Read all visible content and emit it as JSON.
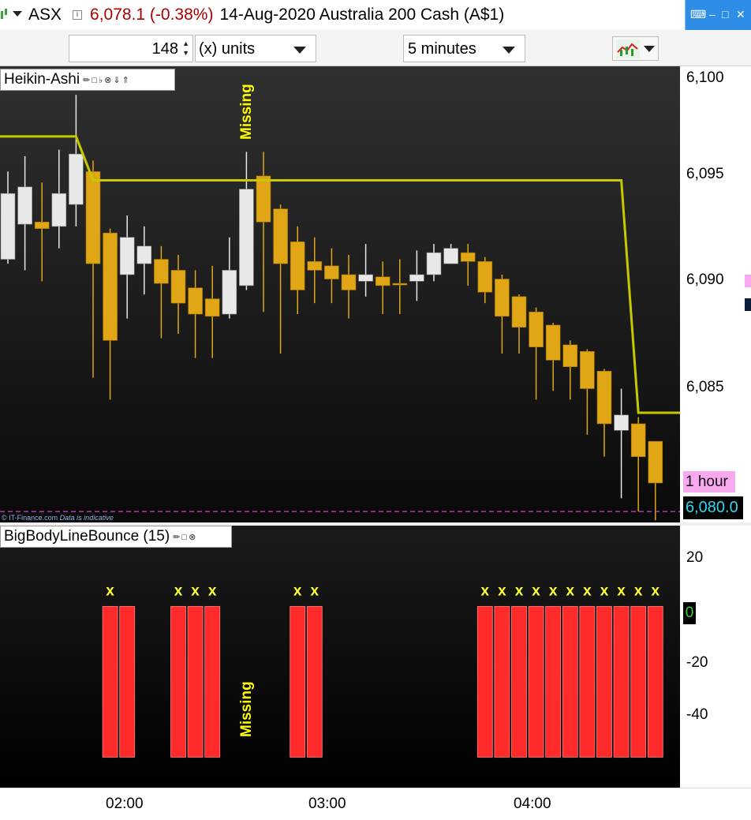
{
  "header": {
    "symbol": "ASX",
    "last": "6,078.1 (-0.38%)",
    "description": "14-Aug-2020 Australia 200 Cash (A$1)",
    "info_icon": "info-icon",
    "window_controls": [
      "keyboard-icon",
      "minimize-icon",
      "restore-icon",
      "close-icon"
    ]
  },
  "toolbar": {
    "quantity": "148",
    "units": "(x) units",
    "period": "5 minutes",
    "chart_type_icon": "chart-type-icon"
  },
  "price_pane": {
    "legend": "Heikin-Ashi",
    "missing_label": "Missing",
    "credit": "© IT-Finance.com",
    "credit_note": "Data is indicative",
    "hour_badge": "1 hour",
    "last_price": "6,080.0",
    "y_ticks": [
      "6,100",
      "6,095",
      "6,090",
      "6,085"
    ],
    "colors": {
      "bull": "#e8e8e8",
      "bear": "#e0a616",
      "line": "#c8c800",
      "dash": "#d23fd2"
    }
  },
  "indicator_pane": {
    "legend": "BigBodyLineBounce (15)",
    "missing_label": "Missing",
    "zero_badge": "0",
    "y_ticks": [
      "20",
      "-20",
      "-40"
    ],
    "marker": "x",
    "colors": {
      "bar": "#ff2a2a",
      "marker": "#ffff33"
    }
  },
  "x_axis": {
    "ticks": [
      "02:00",
      "03:00",
      "04:00"
    ]
  },
  "chart_data": [
    {
      "type": "candlestick",
      "title": "Heikin-Ashi",
      "ylim": [
        6079.5,
        6100.3
      ],
      "candles": [
        {
          "o": 6091.5,
          "c": 6094.5,
          "h": 6095.5,
          "l": 6091.3,
          "bull": true
        },
        {
          "o": 6093.1,
          "c": 6094.8,
          "h": 6096.2,
          "l": 6091.0,
          "bull": true
        },
        {
          "o": 6092.9,
          "c": 6093.2,
          "h": 6095.0,
          "l": 6090.5,
          "bull": false
        },
        {
          "o": 6093.0,
          "c": 6094.5,
          "h": 6096.5,
          "l": 6092.0,
          "bull": true
        },
        {
          "o": 6094.0,
          "c": 6096.3,
          "h": 6099.0,
          "l": 6093.0,
          "bull": true
        },
        {
          "o": 6095.5,
          "c": 6091.3,
          "h": 6096.0,
          "l": 6086.1,
          "bull": false
        },
        {
          "o": 6092.7,
          "c": 6087.8,
          "h": 6092.9,
          "l": 6085.1,
          "bull": false
        },
        {
          "o": 6090.8,
          "c": 6092.5,
          "h": 6093.5,
          "l": 6088.8,
          "bull": true
        },
        {
          "o": 6091.3,
          "c": 6092.1,
          "h": 6093.0,
          "l": 6089.9,
          "bull": true
        },
        {
          "o": 6091.5,
          "c": 6090.4,
          "h": 6092.1,
          "l": 6087.9,
          "bull": false
        },
        {
          "o": 6091.0,
          "c": 6089.5,
          "h": 6091.7,
          "l": 6088.1,
          "bull": false
        },
        {
          "o": 6090.2,
          "c": 6089.0,
          "h": 6091.0,
          "l": 6087.0,
          "bull": false
        },
        {
          "o": 6089.7,
          "c": 6088.9,
          "h": 6091.2,
          "l": 6087.0,
          "bull": false
        },
        {
          "o": 6089.0,
          "c": 6091.0,
          "h": 6092.5,
          "l": 6088.8,
          "bull": true
        },
        {
          "o": 6090.3,
          "c": 6094.7,
          "h": 6096.4,
          "l": 6090.1,
          "bull": true
        },
        {
          "o": 6095.3,
          "c": 6093.2,
          "h": 6096.4,
          "l": 6089.1,
          "bull": false
        },
        {
          "o": 6093.8,
          "c": 6091.3,
          "h": 6094.0,
          "l": 6087.2,
          "bull": false
        },
        {
          "o": 6092.3,
          "c": 6090.1,
          "h": 6093.0,
          "l": 6089.0,
          "bull": false
        },
        {
          "o": 6091.0,
          "c": 6091.4,
          "h": 6092.5,
          "l": 6089.5,
          "bull": false
        },
        {
          "o": 6091.2,
          "c": 6090.6,
          "h": 6092.0,
          "l": 6089.5,
          "bull": false
        },
        {
          "o": 6090.8,
          "c": 6090.1,
          "h": 6091.7,
          "l": 6088.8,
          "bull": false
        },
        {
          "o": 6090.5,
          "c": 6090.8,
          "h": 6092.2,
          "l": 6089.8,
          "bull": true
        },
        {
          "o": 6090.7,
          "c": 6090.3,
          "h": 6091.4,
          "l": 6089.0,
          "bull": false
        },
        {
          "o": 6090.4,
          "c": 6090.4,
          "h": 6091.5,
          "l": 6089.0,
          "bull": false
        },
        {
          "o": 6090.5,
          "c": 6090.8,
          "h": 6091.9,
          "l": 6089.6,
          "bull": true
        },
        {
          "o": 6090.8,
          "c": 6091.8,
          "h": 6092.2,
          "l": 6090.5,
          "bull": true
        },
        {
          "o": 6091.3,
          "c": 6092.0,
          "h": 6092.2,
          "l": 6091.3,
          "bull": true
        },
        {
          "o": 6091.8,
          "c": 6091.4,
          "h": 6092.2,
          "l": 6090.3,
          "bull": false
        },
        {
          "o": 6091.4,
          "c": 6090.0,
          "h": 6091.6,
          "l": 6089.5,
          "bull": false
        },
        {
          "o": 6090.6,
          "c": 6088.9,
          "h": 6090.8,
          "l": 6087.2,
          "bull": false
        },
        {
          "o": 6089.8,
          "c": 6088.4,
          "h": 6089.9,
          "l": 6087.2,
          "bull": false
        },
        {
          "o": 6089.1,
          "c": 6087.5,
          "h": 6089.3,
          "l": 6085.1,
          "bull": false
        },
        {
          "o": 6088.5,
          "c": 6086.9,
          "h": 6088.6,
          "l": 6085.5,
          "bull": false
        },
        {
          "o": 6087.6,
          "c": 6086.6,
          "h": 6087.8,
          "l": 6085.1,
          "bull": false
        },
        {
          "o": 6087.3,
          "c": 6085.6,
          "h": 6087.4,
          "l": 6083.5,
          "bull": false
        },
        {
          "o": 6086.4,
          "c": 6084.0,
          "h": 6086.5,
          "l": 6082.5,
          "bull": false
        },
        {
          "o": 6084.4,
          "c": 6083.7,
          "h": 6085.6,
          "l": 6080.6,
          "bull": true
        },
        {
          "o": 6084.0,
          "c": 6082.5,
          "h": 6084.3,
          "l": 6080.0,
          "bull": false
        },
        {
          "o": 6083.2,
          "c": 6081.3,
          "h": 6083.2,
          "l": 6079.6,
          "bull": false
        }
      ],
      "line": [
        6097.1,
        6097.1,
        6097.1,
        6097.1,
        6097.1,
        6095.1,
        6095.1,
        6095.1,
        6095.1,
        6095.1,
        6095.1,
        6095.1,
        6095.1,
        6095.1,
        6095.1,
        6095.1,
        6095.1,
        6095.1,
        6095.1,
        6095.1,
        6095.1,
        6095.1,
        6095.1,
        6095.1,
        6095.1,
        6095.1,
        6095.1,
        6095.1,
        6095.1,
        6095.1,
        6095.1,
        6095.1,
        6095.1,
        6095.1,
        6095.1,
        6095.1,
        6095.1,
        6084.5,
        6084.5
      ],
      "dashed_level": 6080.0
    },
    {
      "type": "bar",
      "title": "BigBodyLineBounce (15)",
      "ylim": [
        -60,
        26
      ],
      "values": [
        0,
        0,
        0,
        0,
        0,
        0,
        -50,
        -50,
        0,
        0,
        -50,
        -50,
        -50,
        0,
        0,
        0,
        0,
        -50,
        -50,
        0,
        0,
        0,
        0,
        0,
        0,
        0,
        0,
        0,
        -50,
        -50,
        -50,
        -50,
        -50,
        -50,
        -50,
        -50,
        -50,
        -50,
        -50
      ],
      "markers": [
        false,
        false,
        false,
        false,
        false,
        false,
        true,
        false,
        false,
        false,
        true,
        true,
        true,
        false,
        false,
        false,
        false,
        true,
        true,
        false,
        false,
        false,
        false,
        false,
        false,
        false,
        false,
        false,
        true,
        true,
        true,
        true,
        true,
        true,
        true,
        true,
        true,
        true,
        true
      ]
    }
  ]
}
